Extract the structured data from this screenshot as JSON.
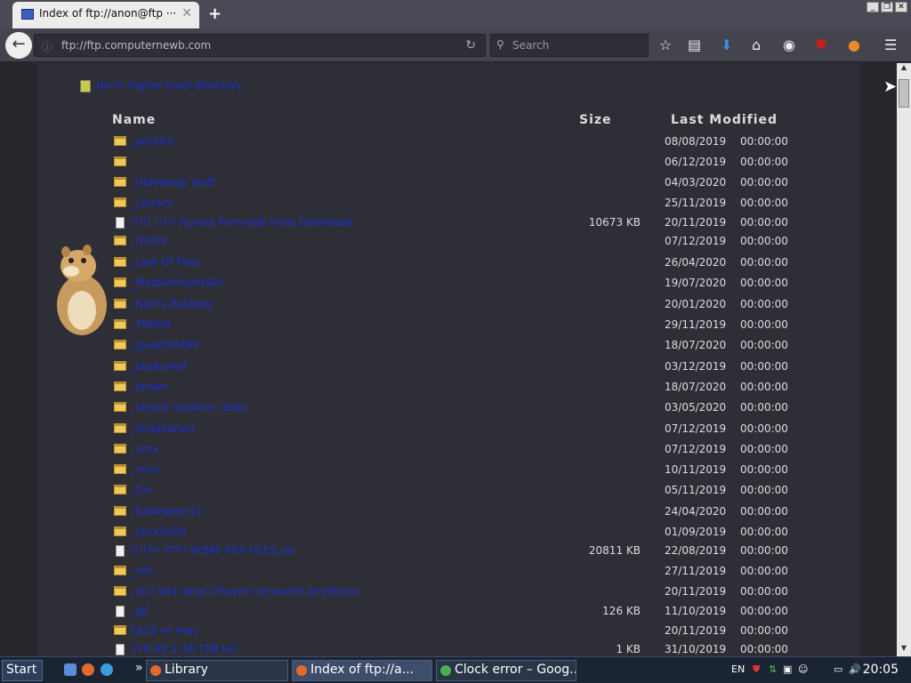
{
  "browser": {
    "tab_title": "Index of ftp://anon@ftp ···",
    "url": "ftp://ftp.computernewb.com",
    "search_placeholder": "Search"
  },
  "page": {
    "up_link": "Up to higher level directory",
    "headers": {
      "name": "Name",
      "size": "Size",
      "modified": "Last Modified"
    },
    "rows": [
      {
        "type": "folder",
        "name": "_jm00ch",
        "size": "",
        "date": "08/08/2019",
        "time": "00:00:00"
      },
      {
        "type": "folder",
        "name": "",
        "size": "",
        "date": "06/12/2019",
        "time": "00:00:00"
      },
      {
        "type": "folder",
        "name": "_Hideaway stuff",
        "size": "",
        "date": "04/03/2020",
        "time": "00:00:00"
      },
      {
        "type": "folder",
        "name": "_Library",
        "size": "",
        "date": "25/11/2019",
        "time": "00:00:00"
      },
      {
        "type": "file",
        "name": "!!!!! !!!!! Aurora Porn-eldr Frost Download",
        "size": "10673 KB",
        "date": "20/11/2019",
        "time": "00:00:00"
      },
      {
        "type": "folder",
        "name": "_ITSOS",
        "size": "",
        "date": "07/12/2019",
        "time": "00:00:00"
      },
      {
        "type": "folder",
        "name": "_Last Of Files",
        "size": "",
        "date": "26/04/2020",
        "time": "00:00:00"
      },
      {
        "type": "folder",
        "name": "_MediArchive(SP)",
        "size": "",
        "date": "19/07/2020",
        "time": "00:00:00"
      },
      {
        "type": "folder",
        "name": "_Nick's Backlog",
        "size": "",
        "date": "20/01/2020",
        "time": "00:00:00"
      },
      {
        "type": "folder",
        "name": "_TRASH",
        "size": "",
        "date": "29/11/2019",
        "time": "00:00:00"
      },
      {
        "type": "folder",
        "name": "_guest50489",
        "size": "",
        "date": "18/07/2020",
        "time": "00:00:00"
      },
      {
        "type": "folder",
        "name": "_bookshelf",
        "size": "",
        "date": "03/12/2019",
        "time": "00:00:00"
      },
      {
        "type": "folder",
        "name": "_brown",
        "size": "",
        "date": "18/07/2020",
        "time": "00:00:00"
      },
      {
        "type": "folder",
        "name": "_recent random cards",
        "size": "",
        "date": "03/05/2020",
        "time": "00:00:00"
      },
      {
        "type": "folder",
        "name": "_installation",
        "size": "",
        "date": "07/12/2019",
        "time": "00:00:00"
      },
      {
        "type": "folder",
        "name": "_nmx",
        "size": "",
        "date": "07/12/2019",
        "time": "00:00:00"
      },
      {
        "type": "folder",
        "name": "_misc",
        "size": "",
        "date": "10/11/2019",
        "time": "00:00:00"
      },
      {
        "type": "folder",
        "name": "_fun",
        "size": "",
        "date": "05/11/2019",
        "time": "00:00:00"
      },
      {
        "type": "folder",
        "name": "_halloween11",
        "size": "",
        "date": "24/04/2020",
        "time": "00:00:00"
      },
      {
        "type": "folder",
        "name": "_nmx2020",
        "size": "",
        "date": "01/09/2019",
        "time": "00:00:00"
      },
      {
        "type": "file",
        "name": "!!!!!!! YTF! SOME PS3 FILES.rar",
        "size": "20811 KB",
        "date": "22/08/2019",
        "time": "00:00:00"
      },
      {
        "type": "folder",
        "name": "_net",
        "size": "",
        "date": "27/11/2019",
        "time": "00:00:00"
      },
      {
        "type": "folder",
        "name": "_incl and what (theyre not worth anything)",
        "size": "",
        "date": "20/11/2019",
        "time": "00:00:00"
      },
      {
        "type": "file",
        "name": "_gif",
        "size": "126 KB",
        "date": "11/10/2019",
        "time": "00:00:00"
      },
      {
        "type": "folder",
        "name": "1024 vs mac",
        "size": "",
        "date": "20/11/2019",
        "time": "00:00:00"
      },
      {
        "type": "file",
        "name": "170.45.1.18 T1B.txt",
        "size": "1 KB",
        "date": "31/10/2019",
        "time": "00:00:00"
      }
    ]
  },
  "taskbar": {
    "start": "Start",
    "tasks": [
      "Library",
      "Index of ftp://a...",
      "Clock error – Goog..."
    ],
    "lang": "EN",
    "clock": "20:05"
  },
  "colors": {
    "link": "#1a2fd0",
    "page_bg": "#2e2e36",
    "folder": "#f0c85a"
  }
}
